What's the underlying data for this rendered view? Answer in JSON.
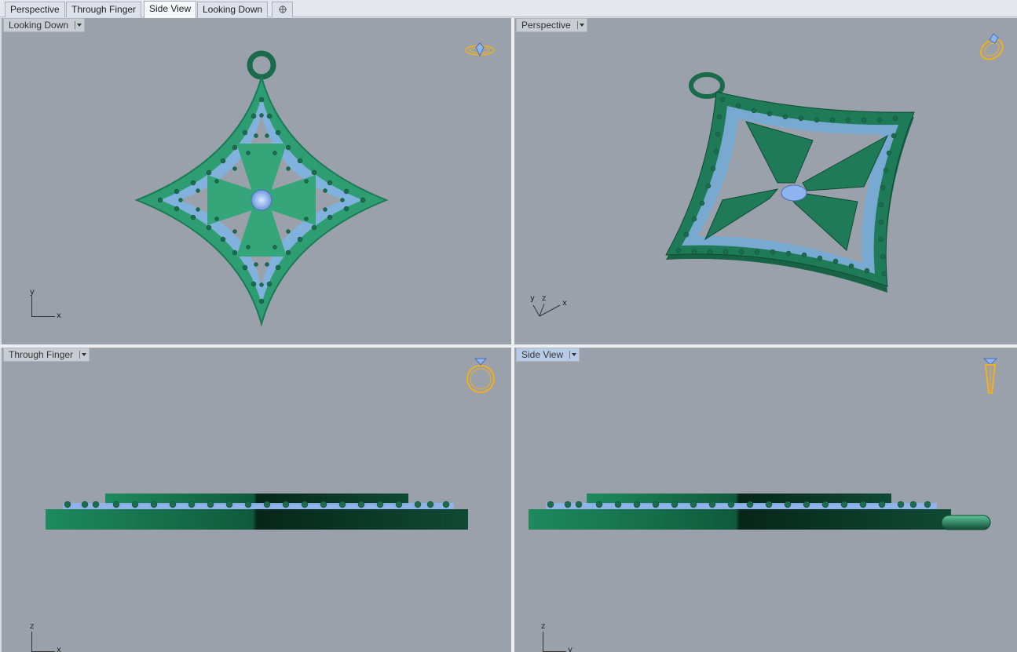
{
  "tabs": [
    {
      "label": "Perspective"
    },
    {
      "label": "Through Finger"
    },
    {
      "label": "Side View",
      "active": true
    },
    {
      "label": "Looking Down"
    }
  ],
  "viewports": {
    "top_left": {
      "title": "Looking Down",
      "icon": "ring-top-view-icon",
      "axes": {
        "vertical": "y",
        "horizontal": "x"
      }
    },
    "top_right": {
      "title": "Perspective",
      "icon": "ring-perspective-icon",
      "axes": {
        "a": "y",
        "b": "z",
        "c": "x"
      }
    },
    "bottom_left": {
      "title": "Through Finger",
      "icon": "ring-front-view-icon",
      "axes": {
        "vertical": "z",
        "horizontal": "x"
      }
    },
    "bottom_right": {
      "title": "Side View",
      "active": true,
      "icon": "ring-side-view-icon",
      "axes": {
        "vertical": "z",
        "horizontal": "y"
      }
    }
  },
  "colors": {
    "metal": "#2e9e72",
    "metal_dark": "#1a6b4b",
    "gem": "#8fb5f0",
    "viewport_bg": "#9ba1aa",
    "icon_accent": "#f0b020"
  }
}
